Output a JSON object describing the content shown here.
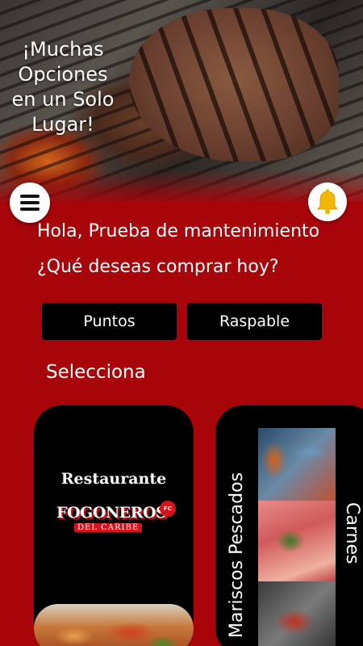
{
  "hero": {
    "tagline": "¡Muchas Opciones en un Solo Lugar!"
  },
  "header": {
    "menu_icon": "hamburger-menu-icon",
    "notification_icon": "bell-icon"
  },
  "greeting": "Hola, Prueba de mantenimiento",
  "question": "¿Qué deseas comprar hoy?",
  "actions": {
    "points_label": "Puntos",
    "scratch_label": "Raspable"
  },
  "section_label": "Selecciona",
  "categories": {
    "restaurant": {
      "title": "Restaurante",
      "logo_main": "FOGONEROS",
      "logo_sub": "DEL CARIBE",
      "logo_badge": "FC"
    },
    "seafood": {
      "label": "Mariscos Pescados"
    },
    "meats": {
      "label": "Carnes"
    }
  },
  "colors": {
    "background": "#a8050b",
    "button": "#000000",
    "bell": "#f2b705"
  }
}
